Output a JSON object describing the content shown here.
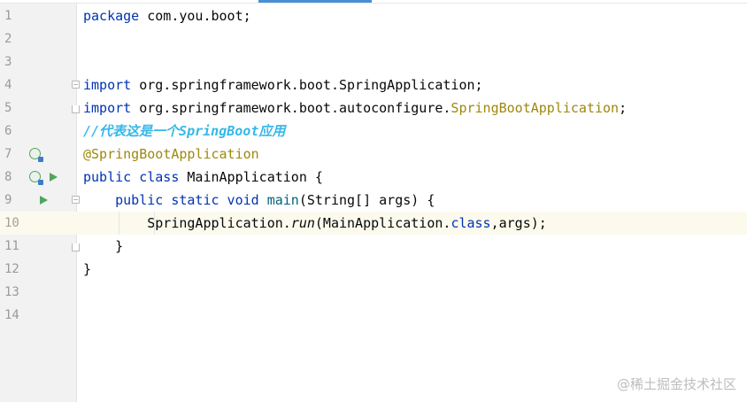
{
  "editor": {
    "lines": [
      {
        "num": "1",
        "tokens": [
          {
            "text": "package ",
            "cls": "kw"
          },
          {
            "text": "com.you.boot;",
            "cls": ""
          }
        ]
      },
      {
        "num": "2",
        "tokens": []
      },
      {
        "num": "3",
        "tokens": []
      },
      {
        "num": "4",
        "tokens": [
          {
            "text": "import ",
            "cls": "kw"
          },
          {
            "text": "org.springframework.boot.SpringApplication;",
            "cls": ""
          }
        ]
      },
      {
        "num": "5",
        "tokens": [
          {
            "text": "import ",
            "cls": "kw"
          },
          {
            "text": "org.springframework.boot.autoconfigure.",
            "cls": ""
          },
          {
            "text": "SpringBootApplication",
            "cls": "ann"
          },
          {
            "text": ";",
            "cls": ""
          }
        ]
      },
      {
        "num": "6",
        "tokens": [
          {
            "text": "//代表这是一个SpringBoot应用",
            "cls": "cmt"
          }
        ]
      },
      {
        "num": "7",
        "tokens": [
          {
            "text": "@SpringBootApplication",
            "cls": "ann"
          }
        ]
      },
      {
        "num": "8",
        "tokens": [
          {
            "text": "public class ",
            "cls": "kw"
          },
          {
            "text": "MainApplication {",
            "cls": ""
          }
        ]
      },
      {
        "num": "9",
        "tokens": [
          {
            "text": "    ",
            "cls": ""
          },
          {
            "text": "public static void ",
            "cls": "kw"
          },
          {
            "text": "main",
            "cls": "fn"
          },
          {
            "text": "(String[] args) {",
            "cls": ""
          }
        ]
      },
      {
        "num": "10",
        "tokens": [
          {
            "text": "        SpringApplication.",
            "cls": ""
          },
          {
            "text": "run",
            "cls": "it"
          },
          {
            "text": "(MainApplication.",
            "cls": ""
          },
          {
            "text": "class",
            "cls": "kwc"
          },
          {
            "text": ",args);",
            "cls": ""
          }
        ]
      },
      {
        "num": "11",
        "tokens": [
          {
            "text": "    }",
            "cls": ""
          }
        ]
      },
      {
        "num": "12",
        "tokens": [
          {
            "text": "}",
            "cls": ""
          }
        ]
      },
      {
        "num": "13",
        "tokens": []
      },
      {
        "num": "14",
        "tokens": []
      }
    ],
    "current_line": 10
  },
  "gutter_icons": {
    "line7": [
      "spring-bean-icon"
    ],
    "line8": [
      "spring-bean-icon",
      "run-icon"
    ],
    "line9": [
      "run-icon"
    ]
  },
  "colors": {
    "keyword": "#0033b3",
    "annotation": "#9e880d",
    "comment": "#36b8e8",
    "current_line_bg": "#fcfaed",
    "run_icon": "#4fa65a"
  },
  "watermark": "@稀土掘金技术社区"
}
